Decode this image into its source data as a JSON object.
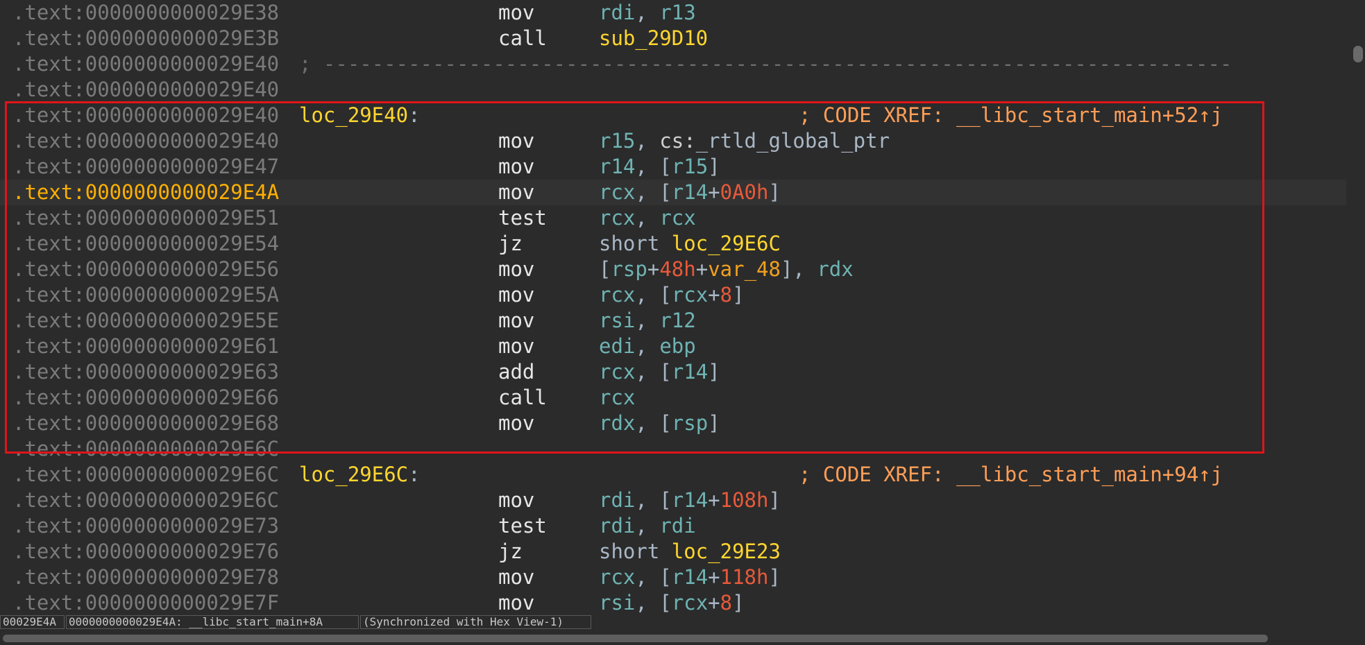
{
  "listing": {
    "lines": [
      {
        "addr": ".text:0000000000029E38",
        "mnem": "mov",
        "ops": [
          [
            "reg",
            "rdi"
          ],
          [
            "punc",
            ", "
          ],
          [
            "reg",
            "r13"
          ]
        ]
      },
      {
        "addr": ".text:0000000000029E3B",
        "mnem": "call",
        "ops": [
          [
            "sym",
            "sub_29D10"
          ]
        ]
      },
      {
        "addr": ".text:0000000000029E40",
        "separator": "; ---------------------------------------------------------------------------"
      },
      {
        "addr": ".text:0000000000029E40"
      },
      {
        "addr": ".text:0000000000029E40",
        "label": "loc_29E40",
        "comment": "; CODE XREF: __libc_start_main+52↑j"
      },
      {
        "addr": ".text:0000000000029E40",
        "mnem": "mov",
        "ops": [
          [
            "reg",
            "r15"
          ],
          [
            "punc",
            ", "
          ],
          [
            "kw",
            "cs:"
          ],
          [
            "punc",
            "_rtld_global_ptr"
          ]
        ]
      },
      {
        "addr": ".text:0000000000029E47",
        "mnem": "mov",
        "ops": [
          [
            "reg",
            "r14"
          ],
          [
            "punc",
            ", ["
          ],
          [
            "reg",
            "r15"
          ],
          [
            "punc",
            "]"
          ]
        ]
      },
      {
        "addr": ".text:0000000000029E4A",
        "current": true,
        "mnem": "mov",
        "ops": [
          [
            "reg",
            "rcx"
          ],
          [
            "punc",
            ", ["
          ],
          [
            "reg",
            "r14"
          ],
          [
            "punc",
            "+"
          ],
          [
            "num",
            "0A0h"
          ],
          [
            "punc",
            "]"
          ]
        ]
      },
      {
        "addr": ".text:0000000000029E51",
        "mnem": "test",
        "ops": [
          [
            "reg",
            "rcx"
          ],
          [
            "punc",
            ", "
          ],
          [
            "reg",
            "rcx"
          ]
        ]
      },
      {
        "addr": ".text:0000000000029E54",
        "mnem": "jz",
        "ops": [
          [
            "punc",
            "short "
          ],
          [
            "sym",
            "loc_29E6C"
          ]
        ]
      },
      {
        "addr": ".text:0000000000029E56",
        "mnem": "mov",
        "ops": [
          [
            "punc",
            "["
          ],
          [
            "reg",
            "rsp"
          ],
          [
            "punc",
            "+"
          ],
          [
            "num",
            "48h"
          ],
          [
            "punc",
            "+"
          ],
          [
            "var",
            "var_48"
          ],
          [
            "punc",
            "], "
          ],
          [
            "reg",
            "rdx"
          ]
        ]
      },
      {
        "addr": ".text:0000000000029E5A",
        "mnem": "mov",
        "ops": [
          [
            "reg",
            "rcx"
          ],
          [
            "punc",
            ", ["
          ],
          [
            "reg",
            "rcx"
          ],
          [
            "punc",
            "+"
          ],
          [
            "num",
            "8"
          ],
          [
            "punc",
            "]"
          ]
        ]
      },
      {
        "addr": ".text:0000000000029E5E",
        "mnem": "mov",
        "ops": [
          [
            "reg",
            "rsi"
          ],
          [
            "punc",
            ", "
          ],
          [
            "reg",
            "r12"
          ]
        ]
      },
      {
        "addr": ".text:0000000000029E61",
        "mnem": "mov",
        "ops": [
          [
            "reg",
            "edi"
          ],
          [
            "punc",
            ", "
          ],
          [
            "reg",
            "ebp"
          ]
        ]
      },
      {
        "addr": ".text:0000000000029E63",
        "mnem": "add",
        "ops": [
          [
            "reg",
            "rcx"
          ],
          [
            "punc",
            ", ["
          ],
          [
            "reg",
            "r14"
          ],
          [
            "punc",
            "]"
          ]
        ]
      },
      {
        "addr": ".text:0000000000029E66",
        "mnem": "call",
        "ops": [
          [
            "reg",
            "rcx"
          ]
        ]
      },
      {
        "addr": ".text:0000000000029E68",
        "mnem": "mov",
        "ops": [
          [
            "reg",
            "rdx"
          ],
          [
            "punc",
            ", ["
          ],
          [
            "reg",
            "rsp"
          ],
          [
            "punc",
            "]"
          ]
        ]
      },
      {
        "addr": ".text:0000000000029E6C"
      },
      {
        "addr": ".text:0000000000029E6C",
        "label": "loc_29E6C",
        "comment": "; CODE XREF: __libc_start_main+94↑j"
      },
      {
        "addr": ".text:0000000000029E6C",
        "mnem": "mov",
        "ops": [
          [
            "reg",
            "rdi"
          ],
          [
            "punc",
            ", ["
          ],
          [
            "reg",
            "r14"
          ],
          [
            "punc",
            "+"
          ],
          [
            "num",
            "108h"
          ],
          [
            "punc",
            "]"
          ]
        ]
      },
      {
        "addr": ".text:0000000000029E73",
        "mnem": "test",
        "ops": [
          [
            "reg",
            "rdi"
          ],
          [
            "punc",
            ", "
          ],
          [
            "reg",
            "rdi"
          ]
        ]
      },
      {
        "addr": ".text:0000000000029E76",
        "mnem": "jz",
        "ops": [
          [
            "punc",
            "short "
          ],
          [
            "sym",
            "loc_29E23"
          ]
        ]
      },
      {
        "addr": ".text:0000000000029E78",
        "mnem": "mov",
        "ops": [
          [
            "reg",
            "rcx"
          ],
          [
            "punc",
            ", ["
          ],
          [
            "reg",
            "r14"
          ],
          [
            "punc",
            "+"
          ],
          [
            "num",
            "118h"
          ],
          [
            "punc",
            "]"
          ]
        ]
      },
      {
        "addr": ".text:0000000000029E7F",
        "mnem": "mov",
        "ops": [
          [
            "reg",
            "rsi"
          ],
          [
            "punc",
            ", ["
          ],
          [
            "reg",
            "rcx"
          ],
          [
            "punc",
            "+"
          ],
          [
            "num",
            "8"
          ],
          [
            "punc",
            "]"
          ]
        ]
      }
    ]
  },
  "status": {
    "offset": "00029E4A",
    "location": "0000000000029E4A: __libc_start_main+8A",
    "sync": "(Synchronized with Hex View-1)"
  },
  "colors": {
    "background": "#2b2b2b",
    "address": "#7b7b7b",
    "current_address": "#ffb000",
    "label": "#ffd62f",
    "register": "#6fb3b3",
    "number": "#e8593a",
    "comment": "#ff9e57",
    "highlight_box": "#e0141a"
  }
}
